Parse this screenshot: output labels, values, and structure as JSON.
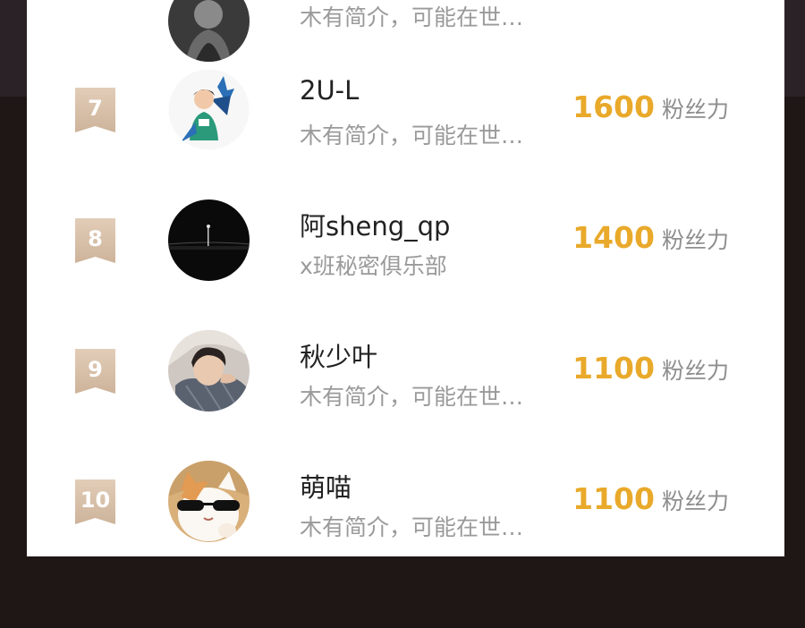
{
  "score_unit": "粉丝力",
  "colors": {
    "accent": "#e9a92a",
    "badge": "#d8c0a8",
    "name": "#222222",
    "bio": "#9a9a9a"
  },
  "ranking": [
    {
      "rank": "",
      "name": "",
      "bio": "木有简介，可能在世…",
      "score": "",
      "avatar": "gray-portrait"
    },
    {
      "rank": "7",
      "name": "2U-L",
      "bio": "木有简介，可能在世…",
      "score": "1600",
      "avatar": "cartoon-boy"
    },
    {
      "rank": "8",
      "name": "阿sheng_qp",
      "bio": "x班秘密俱乐部",
      "score": "1400",
      "avatar": "dark-landscape"
    },
    {
      "rank": "9",
      "name": "秋少叶",
      "bio": "木有简介，可能在世…",
      "score": "1100",
      "avatar": "young-man-photo"
    },
    {
      "rank": "10",
      "name": "萌喵",
      "bio": "木有简介，可能在世…",
      "score": "1100",
      "avatar": "cat-sunglasses"
    }
  ]
}
